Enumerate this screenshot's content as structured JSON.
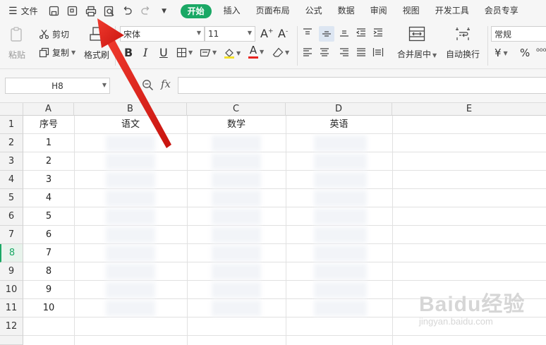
{
  "menubar": {
    "file_label": "文件",
    "tabs": [
      {
        "label": "开始",
        "active": true
      },
      {
        "label": "插入"
      },
      {
        "label": "页面布局"
      },
      {
        "label": "公式"
      },
      {
        "label": "数据"
      },
      {
        "label": "审阅"
      },
      {
        "label": "视图"
      },
      {
        "label": "开发工具"
      },
      {
        "label": "会员专享"
      }
    ]
  },
  "ribbon": {
    "paste_label": "粘贴",
    "cut_label": "剪切",
    "copy_label": "复制",
    "format_painter_label": "格式刷",
    "font_name": "宋体",
    "font_size": "11",
    "merge_label": "合并居中",
    "wrap_label": "自动换行",
    "number_format": "常规",
    "currency_symbol": "¥",
    "percent_symbol": "%"
  },
  "formula_bar": {
    "name_box": "H8",
    "fx_label": "fx",
    "formula": ""
  },
  "sheet": {
    "columns": [
      "A",
      "B",
      "C",
      "D",
      "E"
    ],
    "rows": [
      "1",
      "2",
      "3",
      "4",
      "5",
      "6",
      "7",
      "8",
      "9",
      "10",
      "11",
      "12"
    ],
    "active_row": "8",
    "header_row": [
      "序号",
      "语文",
      "数学",
      "英语"
    ],
    "serials": [
      "1",
      "2",
      "3",
      "4",
      "5",
      "6",
      "7",
      "8",
      "9",
      "10"
    ]
  },
  "colors": {
    "accent": "#1aa865",
    "arrow": "#e8231f"
  },
  "watermark": {
    "logo": "Baidu经验",
    "url": "jingyan.baidu.com"
  }
}
